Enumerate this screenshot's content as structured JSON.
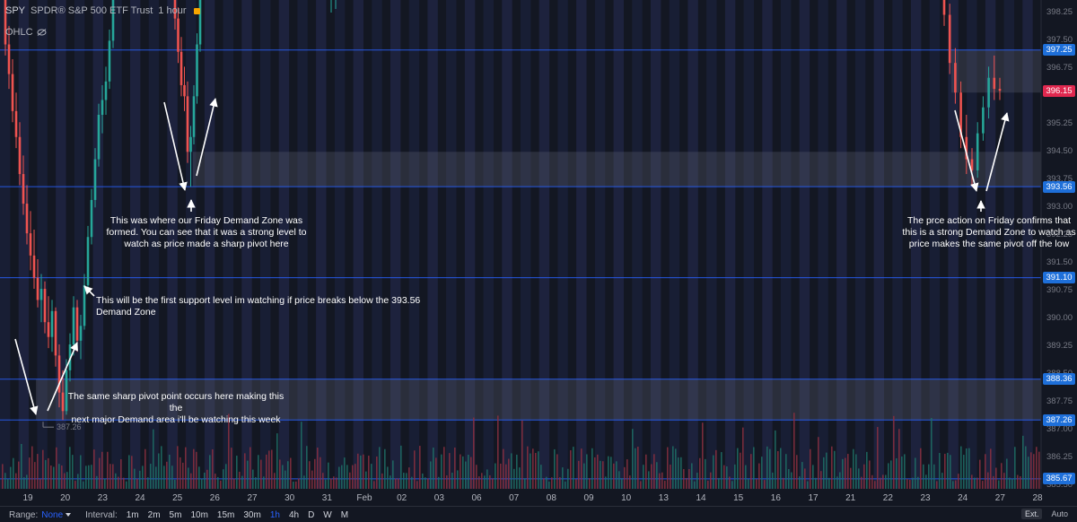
{
  "header": {
    "symbol": "SPY",
    "full_name": "SPDR® S&P 500 ETF Trust",
    "interval": "1 hour",
    "ohlc_label": "OHLC"
  },
  "colors": {
    "background": "#131722",
    "up": "#26a69a",
    "down": "#ef5350",
    "zone_line": "#2962ff",
    "zone_label": "#1e6fd9",
    "current_price_label": "#e0284f",
    "annotation": "#ffffff"
  },
  "annotations": [
    {
      "id": "friday-zone",
      "lines": [
        "This was where our Friday Demand Zone was",
        "formed. You can see that it was a strong level to",
        "watch as price made a sharp pivot here"
      ]
    },
    {
      "id": "first-support",
      "lines": [
        "This will be the first support level im watching if price breaks below the 393.56 Demand Zone"
      ]
    },
    {
      "id": "same-pivot",
      "lines": [
        "The same sharp pivot point occurs here making this the",
        "next major Demand area i'll be watching this week"
      ]
    },
    {
      "id": "price-action",
      "lines": [
        "The prce action on Friday confirms that",
        "this is a strong Demand Zone to watch as",
        "price makes the same pivot off the low"
      ]
    }
  ],
  "toolbar": {
    "range_label": "Range:",
    "range_value": "None",
    "interval_label": "Interval:",
    "intervals": [
      "1m",
      "2m",
      "5m",
      "10m",
      "15m",
      "30m",
      "1h",
      "4h",
      "D",
      "W",
      "M"
    ],
    "active_interval": "1h",
    "ext_label": "Ext.",
    "auto_label": "Auto"
  },
  "low_marker": "387.26",
  "chart_data": {
    "type": "candlestick",
    "title": "",
    "xlabel": "",
    "ylabel": "",
    "ylim": [
      385.4,
      398.6
    ],
    "price_ticks": [
      "398.25",
      "397.50",
      "396.75",
      "395.25",
      "394.50",
      "393.75",
      "393.00",
      "392.25",
      "391.50",
      "390.75",
      "390.00",
      "389.25",
      "388.50",
      "387.75",
      "387.00",
      "386.25",
      "385.50"
    ],
    "date_ticks": [
      "19",
      "20",
      "23",
      "24",
      "25",
      "26",
      "27",
      "30",
      "31",
      "Feb",
      "02",
      "03",
      "06",
      "07",
      "08",
      "09",
      "10",
      "13",
      "14",
      "15",
      "16",
      "17",
      "21",
      "22",
      "23",
      "24",
      "27",
      "28"
    ],
    "levels": [
      397.25,
      393.56,
      391.1,
      388.36,
      387.26,
      385.67
    ],
    "level_labels": [
      "397.25",
      "393.56",
      "391.10",
      "388.36",
      "387.26",
      "385.67"
    ],
    "current_price": 396.15,
    "current_price_label": "396.15",
    "zones": [
      {
        "low": 393.56,
        "high": 394.5
      },
      {
        "low": 387.26,
        "high": 388.36
      },
      {
        "low": 396.1,
        "high": 397.25
      }
    ],
    "candles_left": [
      [
        398.9,
        399.2,
        397.1,
        397.4
      ],
      [
        397.4,
        397.9,
        396.2,
        396.6
      ],
      [
        396.6,
        397.0,
        395.3,
        395.6
      ],
      [
        395.6,
        396.1,
        394.6,
        394.9
      ],
      [
        394.9,
        395.3,
        393.6,
        393.9
      ],
      [
        393.9,
        394.4,
        392.8,
        393.1
      ],
      [
        393.1,
        393.6,
        392.0,
        392.3
      ],
      [
        392.3,
        392.9,
        391.3,
        391.7
      ],
      [
        391.7,
        392.4,
        390.8,
        391.1
      ],
      [
        391.1,
        391.6,
        390.3,
        390.5
      ],
      [
        390.5,
        391.2,
        389.9,
        390.8
      ],
      [
        390.8,
        391.0,
        389.6,
        389.9
      ],
      [
        389.9,
        390.6,
        389.2,
        389.5
      ],
      [
        389.5,
        390.5,
        389.1,
        390.2
      ],
      [
        390.2,
        390.3,
        388.7,
        389.0
      ],
      [
        389.0,
        389.3,
        387.6,
        388.0
      ],
      [
        388.0,
        388.6,
        387.26,
        387.5
      ],
      [
        387.5,
        388.9,
        387.4,
        388.6
      ],
      [
        388.6,
        389.6,
        388.3,
        389.3
      ],
      [
        389.3,
        390.6,
        389.0,
        390.3
      ],
      [
        390.3,
        390.5,
        389.1,
        389.4
      ],
      [
        389.4,
        390.1,
        388.9,
        389.8
      ],
      [
        389.8,
        391.2,
        389.7,
        390.9
      ],
      [
        390.9,
        392.5,
        390.8,
        392.2
      ],
      [
        392.2,
        393.5,
        392.0,
        393.2
      ],
      [
        393.2,
        394.6,
        393.0,
        394.3
      ],
      [
        394.3,
        395.8,
        394.1,
        395.5
      ],
      [
        395.5,
        396.3,
        395.0,
        395.9
      ],
      [
        395.9,
        396.8,
        395.5,
        396.4
      ],
      [
        396.4,
        397.8,
        396.2,
        397.5
      ],
      [
        397.5,
        399.0,
        397.3,
        398.8
      ]
    ],
    "candles_friday": [
      [
        399.0,
        399.5,
        397.8,
        398.1
      ],
      [
        398.1,
        398.4,
        396.9,
        397.2
      ],
      [
        397.2,
        397.6,
        396.0,
        396.3
      ],
      [
        396.3,
        396.8,
        395.6,
        396.0
      ],
      [
        396.0,
        396.4,
        394.2,
        394.5
      ],
      [
        394.5,
        395.2,
        393.56,
        394.9
      ],
      [
        394.9,
        396.3,
        394.7,
        396.0
      ],
      [
        396.0,
        397.7,
        395.8,
        397.4
      ],
      [
        397.4,
        399.2,
        397.2,
        398.9
      ]
    ],
    "candles_right": [
      [
        399.0,
        399.2,
        397.9,
        398.2
      ],
      [
        398.2,
        398.5,
        396.6,
        396.9
      ],
      [
        396.9,
        397.3,
        395.8,
        396.1
      ],
      [
        396.1,
        396.4,
        394.6,
        394.9
      ],
      [
        394.9,
        395.5,
        393.9,
        394.3
      ],
      [
        394.3,
        394.6,
        393.56,
        394.0
      ],
      [
        394.0,
        395.3,
        393.8,
        395.0
      ],
      [
        395.0,
        396.0,
        394.8,
        395.7
      ],
      [
        395.7,
        396.8,
        395.4,
        396.5
      ],
      [
        396.5,
        397.1,
        395.9,
        396.2
      ],
      [
        396.2,
        396.5,
        395.9,
        396.15
      ]
    ]
  }
}
